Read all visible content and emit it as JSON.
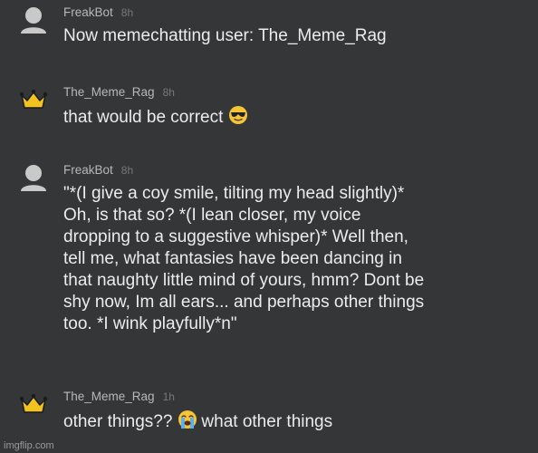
{
  "messages": [
    {
      "author": "FreakBot",
      "time": "8h",
      "avatar_icon": "user-silhouette-icon",
      "text": "Now memechatting user: The_Meme_Rag"
    },
    {
      "author": "The_Meme_Rag",
      "time": "8h",
      "avatar_icon": "crown-icon",
      "text": "that would be correct",
      "emoji": "sunglasses-emoji"
    },
    {
      "author": "FreakBot",
      "time": "8h",
      "avatar_icon": "user-silhouette-icon",
      "text": "\"*(I give a coy smile, tilting my head slightly)*\nOh, is that so? *(I lean closer, my voice\ndropping to a suggestive whisper)* Well then,\ntell me, what fantasies have been dancing in\nthat naughty little mind of yours, hmm? Dont be\nshy now, Im all ears... and perhaps other things\ntoo. *I wink playfully*n\""
    },
    {
      "author": "The_Meme_Rag",
      "time": "1h",
      "avatar_icon": "crown-icon",
      "text_before": "other things??",
      "emoji": "loudly-crying-emoji",
      "text_after": "what other things"
    }
  ],
  "watermark": "imgflip.com",
  "colors": {
    "background": "#353637",
    "message_text": "#ececec",
    "author_text": "#b7b8b9",
    "timestamp_text": "#77787a",
    "crown": "#f2c320",
    "avatar_gray": "#c9c9c9"
  }
}
